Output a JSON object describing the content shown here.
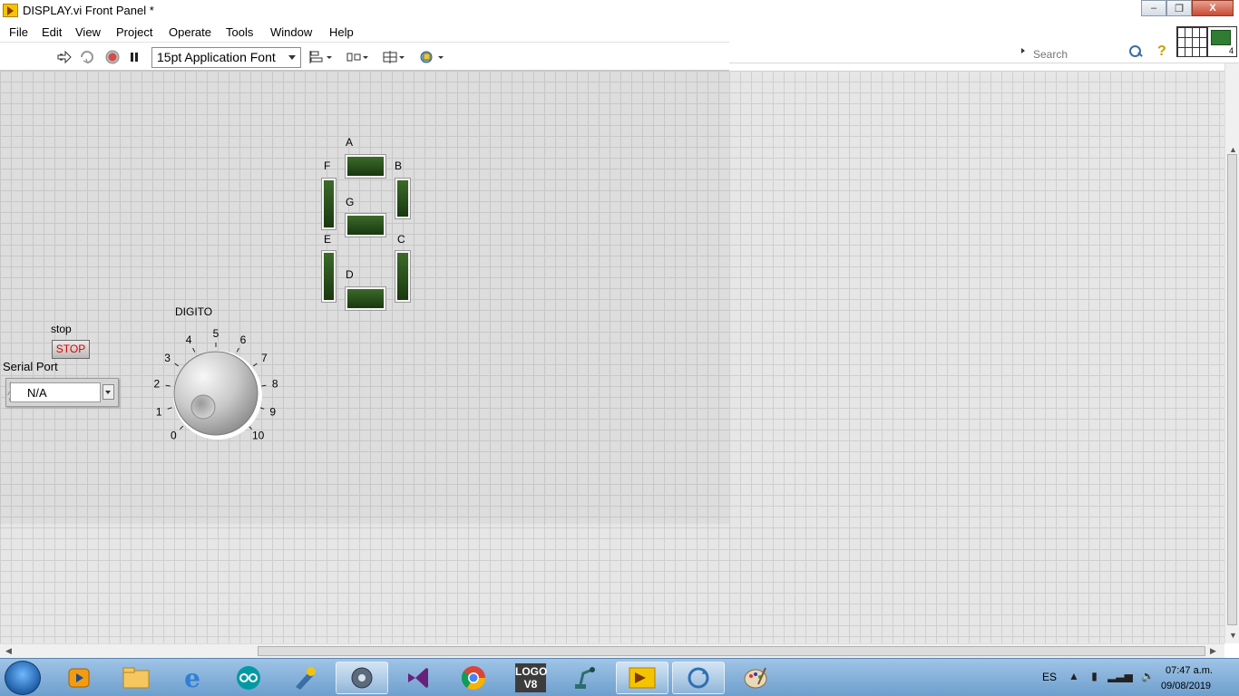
{
  "window": {
    "title": "DISPLAY.vi Front Panel *",
    "minimize": "‒",
    "restore": "❐",
    "close": "X"
  },
  "menu": [
    "File",
    "Edit",
    "View",
    "Project",
    "Operate",
    "Tools",
    "Window",
    "Help"
  ],
  "toolbar": {
    "font_select": "15pt Application Font",
    "search_placeholder": "Search",
    "help_glyph": "?",
    "connector_number": "4"
  },
  "panel": {
    "segments": {
      "A": "A",
      "B": "B",
      "C": "C",
      "D": "D",
      "E": "E",
      "F": "F",
      "G": "G"
    },
    "knob": {
      "label": "DIGITO",
      "ticks": [
        "0",
        "1",
        "2",
        "3",
        "4",
        "5",
        "6",
        "7",
        "8",
        "9",
        "10"
      ],
      "value": 0
    },
    "stop": {
      "label": "stop",
      "button_text": "STOP"
    },
    "serial_port": {
      "label": "Serial Port",
      "value": "N/A"
    }
  },
  "taskbar": {
    "language": "ES",
    "time": "07:47 a.m.",
    "date": "09/08/2019",
    "apps": [
      "windows-media-player",
      "file-explorer",
      "internet-explorer",
      "arduino-ide",
      "app-5",
      "app-6",
      "visual-studio",
      "chrome",
      "logo-v8",
      "app-10",
      "labview",
      "app-12",
      "paint"
    ],
    "logo_text": "LOGO V8"
  },
  "colors": {
    "panel_bg": "#e6e6e6",
    "grid": "#cfcfcf",
    "led_off": "#2a5019",
    "stop_text": "#e00000",
    "taskbar": "#7fadd8"
  }
}
